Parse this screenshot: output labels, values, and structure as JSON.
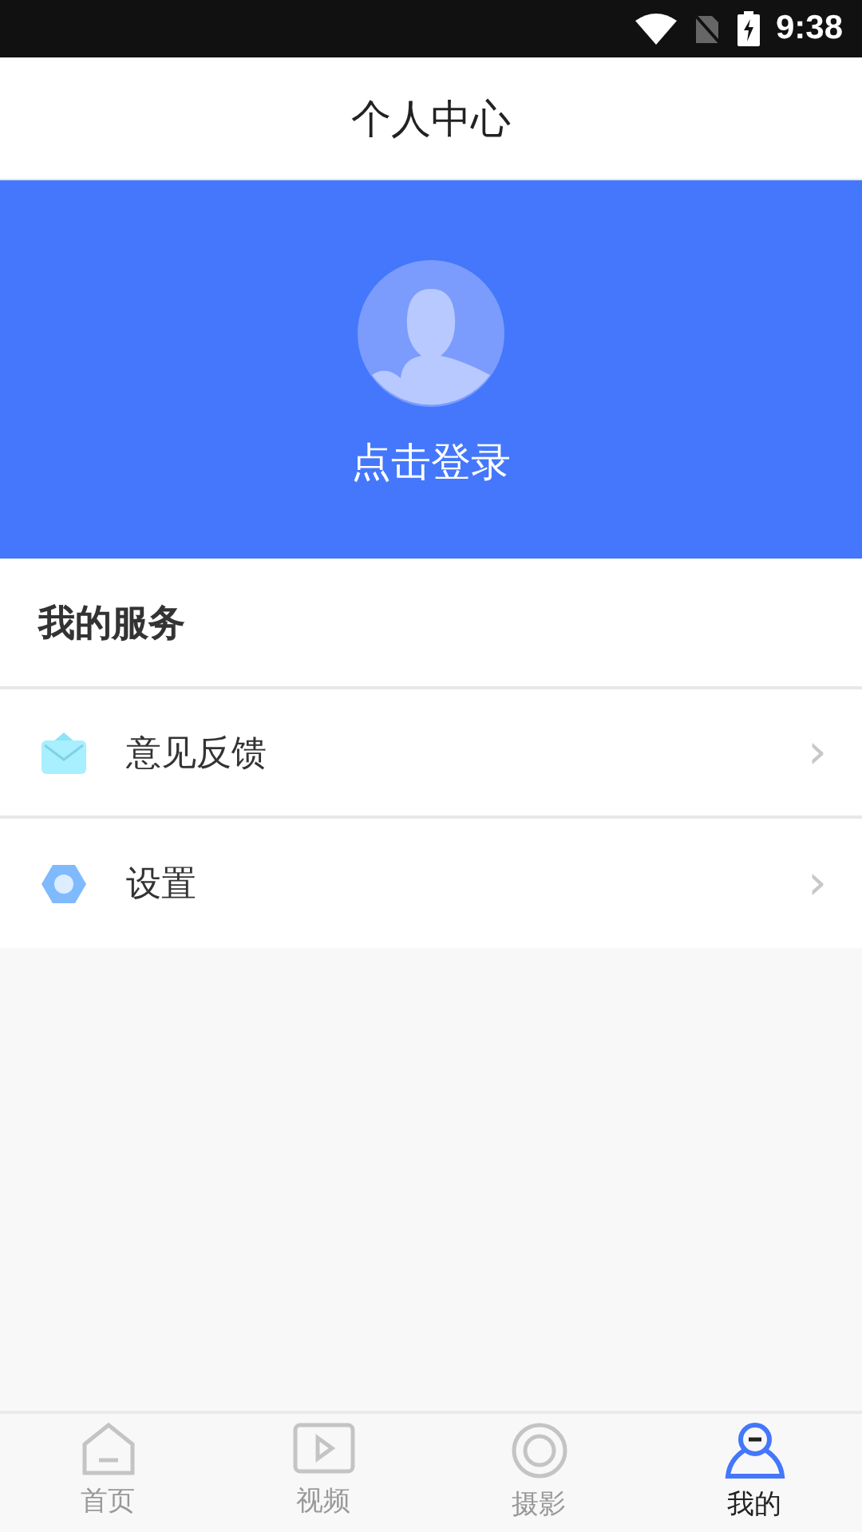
{
  "status_bar": {
    "time": "9:38"
  },
  "header": {
    "title": "个人中心"
  },
  "profile": {
    "login_label": "点击登录"
  },
  "services": {
    "title": "我的服务",
    "items": [
      {
        "kind": "mail",
        "label": "意见反馈",
        "chevron": "›"
      },
      {
        "kind": "gear",
        "label": "设置",
        "chevron": "›"
      }
    ]
  },
  "tabs": [
    {
      "kind": "home",
      "label": "首页",
      "selected": false
    },
    {
      "kind": "video",
      "label": "视频",
      "selected": false
    },
    {
      "kind": "camera",
      "label": "摄影",
      "selected": false
    },
    {
      "kind": "user",
      "label": "我的",
      "selected": true
    }
  ]
}
